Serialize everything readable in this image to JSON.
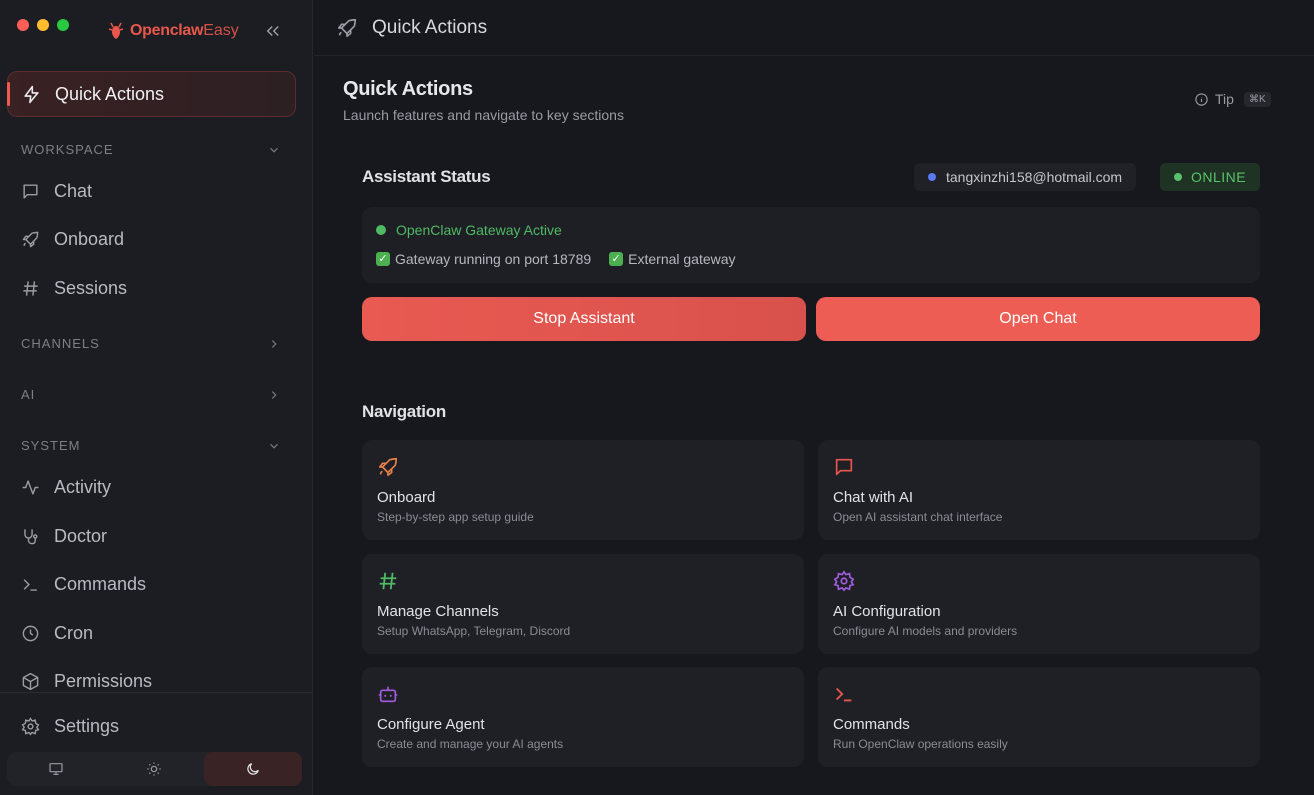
{
  "sidebar": {
    "brand": {
      "name_bold": "Openclaw",
      "name_light": "Easy"
    },
    "active_item": "Quick Actions",
    "sections": {
      "workspace": "WORKSPACE",
      "channels": "CHANNELS",
      "ai": "AI",
      "system": "SYSTEM"
    },
    "workspace_items": [
      "Chat",
      "Onboard",
      "Sessions"
    ],
    "system_items": [
      "Activity",
      "Doctor",
      "Commands",
      "Cron",
      "Permissions"
    ],
    "settings": "Settings"
  },
  "topbar": {
    "title": "Quick Actions"
  },
  "page": {
    "title": "Quick Actions",
    "subtitle": "Launch features and navigate to key sections",
    "tip": "Tip",
    "tip_kbd": "⌘K"
  },
  "assistant": {
    "title": "Assistant Status",
    "email": "tangxinzhi158@hotmail.com",
    "status": "ONLINE",
    "gateway": "OpenClaw Gateway Active",
    "check_1": "Gateway running on port 18789",
    "check_2": "External gateway",
    "stop_button": "Stop Assistant",
    "open_button": "Open Chat"
  },
  "navigation": {
    "title": "Navigation",
    "tiles": [
      {
        "title": "Onboard",
        "desc": "Step-by-step app setup guide"
      },
      {
        "title": "Chat with AI",
        "desc": "Open AI assistant chat interface"
      },
      {
        "title": "Manage Channels",
        "desc": "Setup WhatsApp, Telegram, Discord"
      },
      {
        "title": "AI Configuration",
        "desc": "Configure AI models and providers"
      },
      {
        "title": "Configure Agent",
        "desc": "Create and manage your AI agents"
      },
      {
        "title": "Commands",
        "desc": "Run OpenClaw operations easily"
      }
    ]
  },
  "colors": {
    "accent": "#ee5d54",
    "online": "#5ac26c",
    "email_dot": "#5a7bf0"
  }
}
